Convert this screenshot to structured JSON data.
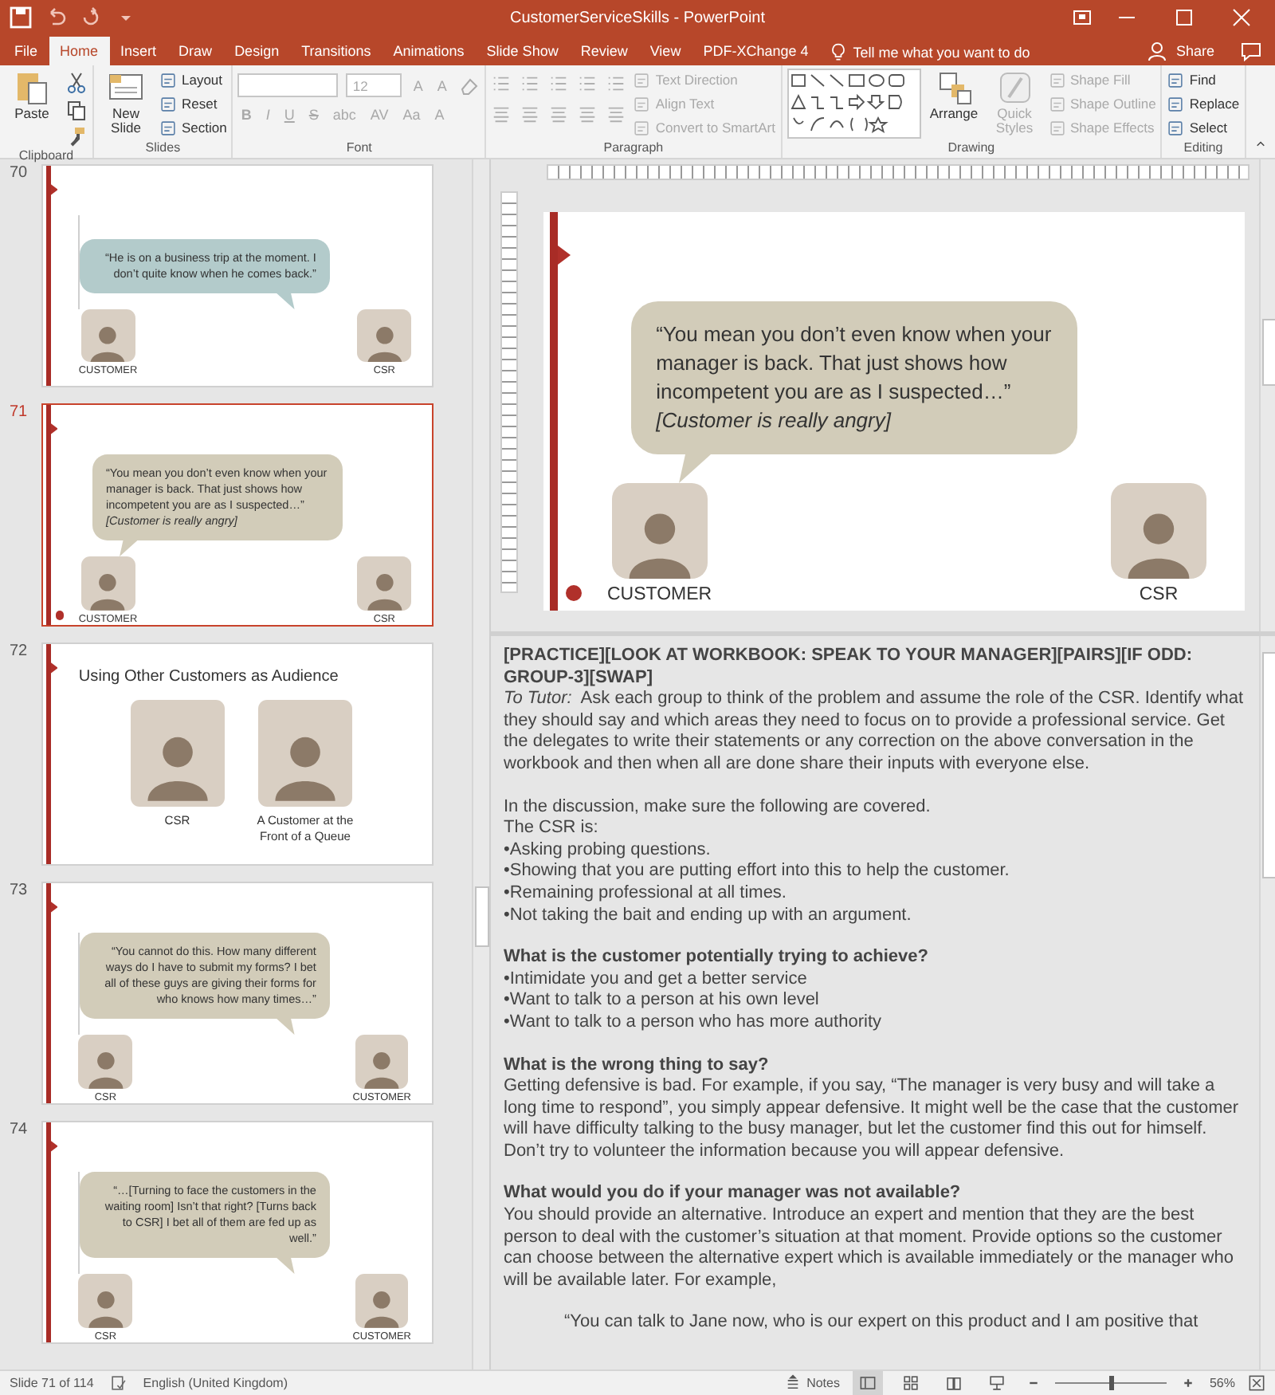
{
  "window": {
    "title": "CustomerServiceSkills  -  PowerPoint"
  },
  "ribbon_tabs": [
    {
      "label": "File",
      "selected": false
    },
    {
      "label": "Home",
      "selected": true
    },
    {
      "label": "Insert",
      "selected": false
    },
    {
      "label": "Draw",
      "selected": false
    },
    {
      "label": "Design",
      "selected": false
    },
    {
      "label": "Transitions",
      "selected": false
    },
    {
      "label": "Animations",
      "selected": false
    },
    {
      "label": "Slide Show",
      "selected": false
    },
    {
      "label": "Review",
      "selected": false
    },
    {
      "label": "View",
      "selected": false
    },
    {
      "label": "PDF-XChange 4",
      "selected": false
    }
  ],
  "tell_me": {
    "placeholder": "Tell me what you want to do"
  },
  "share": "Share",
  "ribbon": [
    {
      "kind": "clipboard",
      "label": "Clipboard",
      "large": [
        {
          "label": "Paste",
          "disabled": false
        }
      ]
    },
    {
      "kind": "slides",
      "label": "Slides",
      "large": [
        {
          "label": "New Slide",
          "disabled": false
        }
      ],
      "small": [
        {
          "label": "Layout",
          "disabled": false
        },
        {
          "label": "Reset",
          "disabled": false
        },
        {
          "label": "Section",
          "disabled": false
        }
      ]
    },
    {
      "kind": "font",
      "label": "Font",
      "font_size": "12",
      "grow_buttons": [
        {
          "label": "A",
          "disabled": true
        },
        {
          "label": "A",
          "disabled": true
        }
      ],
      "format_buttons": [
        {
          "label": "B",
          "disabled": true
        },
        {
          "label": "I",
          "disabled": true
        },
        {
          "label": "U",
          "disabled": true
        },
        {
          "label": "S",
          "disabled": true
        },
        {
          "label": "abc",
          "disabled": true
        },
        {
          "label": "AV",
          "disabled": true
        },
        {
          "label": "Aa",
          "disabled": true
        },
        {
          "label": "A",
          "disabled": true
        }
      ]
    },
    {
      "kind": "paragraph",
      "label": "Paragraph",
      "small": [
        {
          "label": "Text Direction",
          "disabled": true
        },
        {
          "label": "Align Text",
          "disabled": true
        },
        {
          "label": "Convert to SmartArt",
          "disabled": true
        }
      ]
    },
    {
      "kind": "drawing",
      "label": "Drawing",
      "large": [
        {
          "label": "Arrange",
          "disabled": false
        },
        {
          "label": "Quick Styles",
          "disabled": true
        }
      ],
      "small": [
        {
          "label": "Shape Fill",
          "disabled": true
        },
        {
          "label": "Shape Outline",
          "disabled": true
        },
        {
          "label": "Shape Effects",
          "disabled": true
        }
      ]
    },
    {
      "kind": "editing",
      "label": "Editing",
      "small": [
        {
          "label": "Find",
          "disabled": false
        },
        {
          "label": "Replace",
          "disabled": false
        },
        {
          "label": "Select",
          "disabled": false
        }
      ]
    }
  ],
  "slides": [
    {
      "number": "70",
      "selected": false,
      "marker": false,
      "kind": "dialogue",
      "bubble": {
        "text": "“He is on a business trip at the moment. I don’t quite know when he comes back.”",
        "color": "#b3cbcb",
        "tail_left": false
      },
      "people": [
        "CUSTOMER",
        "CSR"
      ]
    },
    {
      "number": "71",
      "selected": true,
      "marker": true,
      "kind": "dialogue",
      "bubble": {
        "text": "“You mean you don’t even know when your manager is back. That just shows how incompetent you are as I suspected…”",
        "note": "[Customer is really angry]",
        "color": "#d2ccb9",
        "tail_left": true
      },
      "people": [
        "CUSTOMER",
        "CSR"
      ]
    },
    {
      "number": "72",
      "selected": false,
      "marker": false,
      "kind": "photos",
      "title": "Using Other Customers as Audience",
      "photos": [
        "CSR",
        "A Customer at the Front of a Queue"
      ]
    },
    {
      "number": "73",
      "selected": false,
      "marker": false,
      "kind": "dialogue",
      "bubble": {
        "text": "“You cannot do this. How many different ways do I have to submit my forms? I bet all of these guys are giving their forms for who knows how many times…”",
        "color": "#d2ccb9",
        "tail_left": false
      },
      "people": [
        "CSR",
        "CUSTOMER"
      ]
    },
    {
      "number": "74",
      "selected": false,
      "marker": false,
      "kind": "dialogue",
      "bubble": {
        "text": "“…[Turning to face the customers in the waiting room] Isn’t that right? [Turns back to CSR] I bet all of them are fed up as well.”",
        "color": "#d2ccb9",
        "tail_left": false
      },
      "people": [
        "CSR",
        "CUSTOMER"
      ]
    }
  ],
  "current_slide": {
    "marker": true,
    "kind": "dialogue",
    "bubble": {
      "text": "“You mean you don’t even know when your manager is back. That just shows how incompetent you are as I suspected…”",
      "note": "[Customer is really angry]",
      "color": "#d2ccb9",
      "tail_left": true
    },
    "people": [
      "CUSTOMER",
      "CSR"
    ]
  },
  "notes": [
    {
      "lines": [
        {
          "kind": "heading",
          "text": "[PRACTICE][LOOK AT WORKBOOK: SPEAK TO YOUR MANAGER][PAIRS][IF ODD: GROUP-3][SWAP]"
        },
        {
          "kind": "text",
          "text": "*To Tutor:*  Ask each group to think of the problem and assume the role of the CSR. Identify what they should say and which areas they need to focus on to provide a professional service. Get the delegates to write their statements or any correction on the above conversation in the workbook and then when all are done share their inputs with everyone else."
        }
      ]
    },
    {
      "lines": [
        {
          "kind": "text",
          "text": "In the discussion, make sure the following are covered."
        },
        {
          "kind": "text",
          "text": "The CSR is:"
        },
        {
          "kind": "text",
          "text": "•Asking probing questions."
        },
        {
          "kind": "text",
          "text": "•Showing that you are putting effort into this to help the customer."
        },
        {
          "kind": "text",
          "text": "•Remaining professional at all times."
        },
        {
          "kind": "text",
          "text": "•Not taking the bait and ending up with an argument."
        }
      ]
    },
    {
      "lines": [
        {
          "kind": "heading",
          "text": "What is the customer potentially trying to achieve?"
        },
        {
          "kind": "text",
          "text": "•Intimidate you and get a better service"
        },
        {
          "kind": "text",
          "text": "•Want to talk to a person at his own level"
        },
        {
          "kind": "text",
          "text": "•Want to talk to a person who has more authority"
        }
      ]
    },
    {
      "lines": [
        {
          "kind": "heading",
          "text": "What is the wrong thing to say?"
        },
        {
          "kind": "text",
          "text": "Getting defensive is bad. For example, if you say, “The manager is very busy and will take a long time to respond”, you simply appear defensive. It might well be the case that the customer will have difficulty talking to the busy manager, but let the customer find this out for himself. Don’t try to volunteer the information because you will appear defensive."
        }
      ]
    },
    {
      "lines": [
        {
          "kind": "heading",
          "text": "What would you do if your manager was not available?"
        },
        {
          "kind": "text",
          "text": "You should provide an alternative. Introduce an expert and mention that they are the best person to deal with the customer’s situation at that moment. Provide options so the customer can choose between the alternative expert which is available immediately or the manager who will be available later. For example,"
        }
      ]
    },
    {
      "lines": [
        {
          "kind": "quote",
          "text": "“You can talk to Jane now, who is our expert on this product and I am positive that"
        }
      ]
    }
  ],
  "status_bar": {
    "slide_info": "Slide 71 of 114",
    "language": "English (United Kingdom)",
    "notes_button": "Notes",
    "views": [
      {
        "selected": true
      },
      {
        "selected": false
      },
      {
        "selected": false
      },
      {
        "selected": false
      }
    ],
    "zoom": {
      "level": 0.5,
      "reading": "56%"
    }
  }
}
